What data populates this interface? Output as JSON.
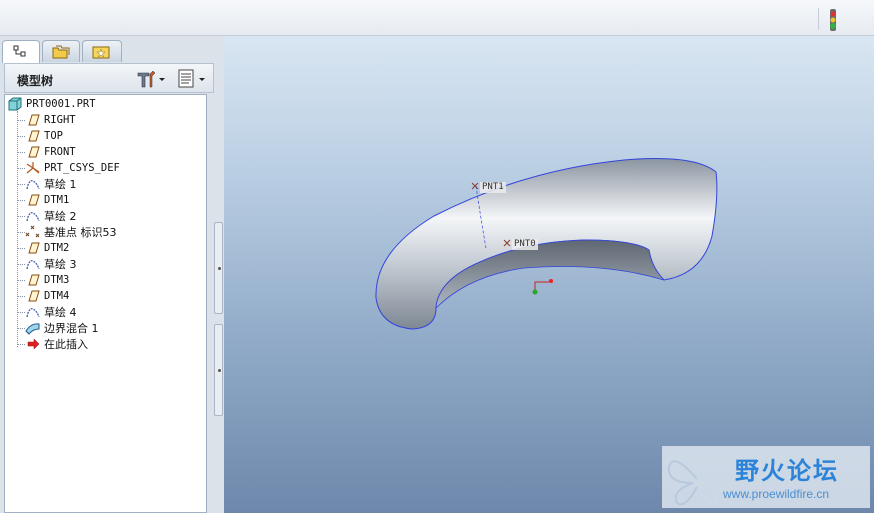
{
  "model_tree": {
    "title": "模型树",
    "items": [
      {
        "label": "PRT0001.PRT",
        "icon": "part-icon"
      },
      {
        "label": "RIGHT",
        "icon": "datum-plane-icon"
      },
      {
        "label": "TOP",
        "icon": "datum-plane-icon"
      },
      {
        "label": "FRONT",
        "icon": "datum-plane-icon"
      },
      {
        "label": "PRT_CSYS_DEF",
        "icon": "coordinate-system-icon"
      },
      {
        "label": "草绘 1",
        "icon": "sketch-icon"
      },
      {
        "label": "DTM1",
        "icon": "datum-plane-icon"
      },
      {
        "label": "草绘 2",
        "icon": "sketch-icon"
      },
      {
        "label": "基准点 标识53",
        "icon": "datum-point-icon"
      },
      {
        "label": "DTM2",
        "icon": "datum-plane-icon"
      },
      {
        "label": "草绘 3",
        "icon": "sketch-icon"
      },
      {
        "label": "DTM3",
        "icon": "datum-plane-icon"
      },
      {
        "label": "DTM4",
        "icon": "datum-plane-icon"
      },
      {
        "label": "草绘 4",
        "icon": "sketch-icon"
      },
      {
        "label": "边界混合 1",
        "icon": "boundary-blend-icon"
      },
      {
        "label": "在此插入",
        "icon": "insert-here-arrow-icon"
      }
    ]
  },
  "viewport": {
    "points": [
      {
        "label": "PNT1"
      },
      {
        "label": "PNT0"
      }
    ]
  },
  "watermark": {
    "name": "野火论坛",
    "url": "www.proewildfire.cn"
  },
  "colors": {
    "accent": "#2c84d8",
    "edge": "#3344dd"
  }
}
